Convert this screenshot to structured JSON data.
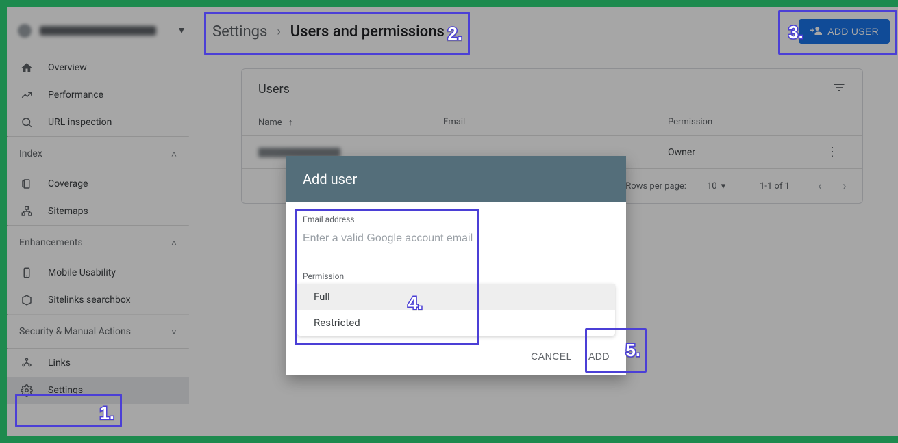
{
  "property_selector": {
    "expand_icon": "▼"
  },
  "sidebar": {
    "items_top": [
      {
        "icon": "home",
        "label": "Overview"
      },
      {
        "icon": "trend",
        "label": "Performance"
      },
      {
        "icon": "search",
        "label": "URL inspection"
      }
    ],
    "section_index": {
      "title": "Index",
      "items": [
        {
          "icon": "coverage",
          "label": "Coverage"
        },
        {
          "icon": "sitemap",
          "label": "Sitemaps"
        }
      ]
    },
    "section_enhancements": {
      "title": "Enhancements",
      "items": [
        {
          "icon": "mobile",
          "label": "Mobile Usability"
        },
        {
          "icon": "sitelinks",
          "label": "Sitelinks searchbox"
        }
      ]
    },
    "section_security": {
      "title": "Security & Manual Actions"
    },
    "items_bottom": [
      {
        "icon": "links",
        "label": "Links"
      },
      {
        "icon": "gear",
        "label": "Settings"
      }
    ]
  },
  "breadcrumb": {
    "root": "Settings",
    "sep": "›",
    "current": "Users and permissions"
  },
  "actions": {
    "add_user": "ADD USER"
  },
  "users_card": {
    "title": "Users",
    "columns": {
      "name": "Name",
      "email": "Email",
      "perm": "Permission",
      "sort": "↑"
    },
    "rows": [
      {
        "perm": "Owner",
        "actions": "⋮"
      }
    ],
    "pagination": {
      "rpp_label": "Rows per page:",
      "rpp_value": "10",
      "range": "1-1 of 1",
      "prev": "‹",
      "next": "›",
      "caret": "▾"
    }
  },
  "modal": {
    "title": "Add user",
    "email_label": "Email address",
    "email_placeholder": "Enter a valid Google account email",
    "perm_label": "Permission",
    "options": [
      "Full",
      "Restricted"
    ],
    "cancel": "CANCEL",
    "add": "ADD"
  },
  "annotations": {
    "n1": "1.",
    "n2": "2.",
    "n3": "3.",
    "n4": "4.",
    "n5": "5."
  }
}
